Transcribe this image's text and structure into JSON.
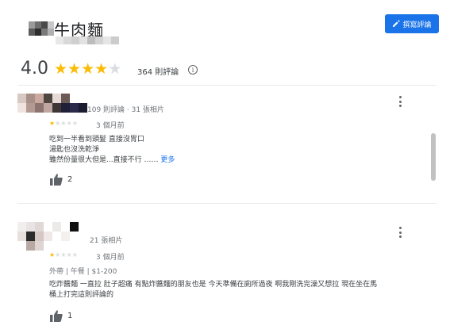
{
  "place": {
    "name": "牛肉麵"
  },
  "header": {
    "write_review_label": "撰寫評論"
  },
  "summary": {
    "rating": "4.0",
    "stars_filled": 4,
    "stars_total": 5,
    "review_count": "364 則評論",
    "info_icon_glyph": "i"
  },
  "reviews": [
    {
      "meta": "109 則評論 · 31 張相片",
      "rating": 1,
      "date": "3 個月前",
      "lines": [
        "吃到一半看到頭髮 直接沒胃口",
        "湯匙也沒洗乾淨"
      ],
      "last_line": "雖然份量很大但是...直接不行 ……",
      "more_label": "更多",
      "likes": "2"
    },
    {
      "meta": "21 張相片",
      "rating": 1,
      "date": "3 個月前",
      "tags": "外帶 | 午餐 | $1-200",
      "lines": [
        "吃炸醬麵 一直拉 肚子超痛 有點炸醬麵的朋友也是 今天準備在廁所過夜 啊我剛洗完澡又想拉 現在坐在馬",
        "桶上打完這則評論的"
      ],
      "likes": "1"
    }
  ],
  "colors": {
    "accent": "#1a73e8",
    "star": "#fbbc04",
    "star_empty": "#dadce0"
  },
  "icons": {
    "write_review": "pencil-icon",
    "like": "thumb-up-icon",
    "menu": "more-vert-icon",
    "info": "info-icon"
  }
}
